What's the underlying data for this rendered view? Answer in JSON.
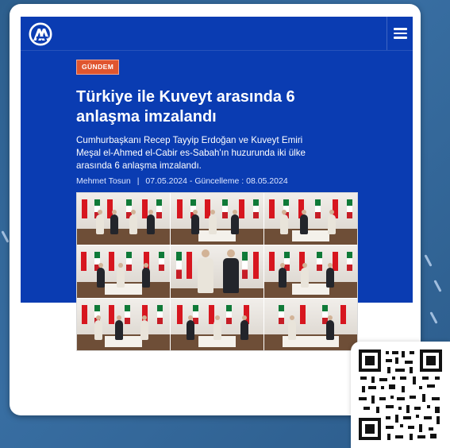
{
  "header": {
    "logo": "AA",
    "logo_icon": "aa-logo-icon",
    "menu_icon": "hamburger-menu-icon"
  },
  "article": {
    "category": "GÜNDEM",
    "headline": "Türkiye ile Kuveyt arasında 6 anlaşma imzalandı",
    "summary": "Cumhurbaşkanı Recep Tayyip Erdoğan ve Kuveyt Emiri Meşal el-Ahmed el-Cabir es-Sabah'ın huzurunda iki ülke arasında 6 anlaşma imzalandı.",
    "author": "Mehmet Tosun",
    "separator": "|",
    "date": "07.05.2024",
    "updated_prefix": "- Güncelleme :",
    "updated_date": "08.05.2024"
  },
  "photo_grid": {
    "count": 9,
    "icon": "signing-ceremony-photo"
  },
  "qr_code": {
    "icon": "qr-code-icon"
  },
  "colors": {
    "panel_blue": "#0a3cb2",
    "badge_orange": "#e0552f",
    "background_blue": "#2f5f8f"
  }
}
